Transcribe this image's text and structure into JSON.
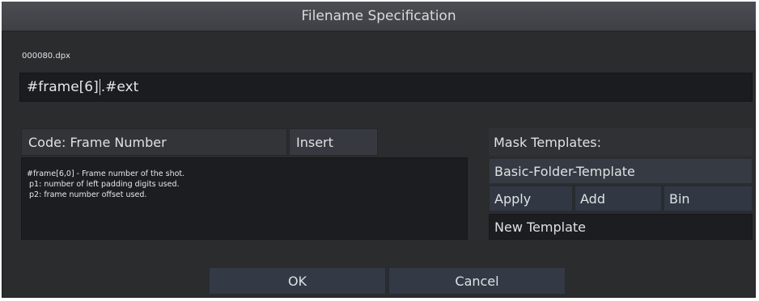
{
  "dialog": {
    "title": "Filename Specification",
    "preview_filename": "000080.dpx",
    "mask_value_before_caret": "#frame[6]",
    "mask_value_after_caret": ".#ext"
  },
  "code": {
    "selected_label": "Code: Frame Number",
    "insert_label": "Insert",
    "help_lines": [
      "#frame[6,0] - Frame number of the shot.",
      " p1: number of left padding digits used.",
      " p2: frame number offset used."
    ]
  },
  "templates": {
    "header_label": "Mask Templates:",
    "selected_template": "Basic-Folder-Template",
    "apply_label": "Apply",
    "add_label": "Add",
    "bin_label": "Bin",
    "new_template_value": "New Template"
  },
  "footer": {
    "ok_label": "OK",
    "cancel_label": "Cancel"
  }
}
